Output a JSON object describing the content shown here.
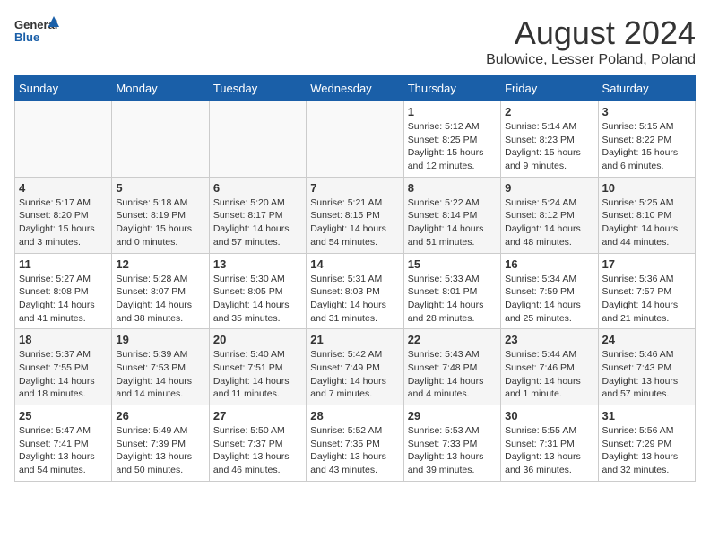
{
  "header": {
    "logo_general": "General",
    "logo_blue": "Blue",
    "month_title": "August 2024",
    "subtitle": "Bulowice, Lesser Poland, Poland"
  },
  "days_of_week": [
    "Sunday",
    "Monday",
    "Tuesday",
    "Wednesday",
    "Thursday",
    "Friday",
    "Saturday"
  ],
  "weeks": [
    [
      {
        "day": "",
        "info": ""
      },
      {
        "day": "",
        "info": ""
      },
      {
        "day": "",
        "info": ""
      },
      {
        "day": "",
        "info": ""
      },
      {
        "day": "1",
        "info": "Sunrise: 5:12 AM\nSunset: 8:25 PM\nDaylight: 15 hours\nand 12 minutes."
      },
      {
        "day": "2",
        "info": "Sunrise: 5:14 AM\nSunset: 8:23 PM\nDaylight: 15 hours\nand 9 minutes."
      },
      {
        "day": "3",
        "info": "Sunrise: 5:15 AM\nSunset: 8:22 PM\nDaylight: 15 hours\nand 6 minutes."
      }
    ],
    [
      {
        "day": "4",
        "info": "Sunrise: 5:17 AM\nSunset: 8:20 PM\nDaylight: 15 hours\nand 3 minutes."
      },
      {
        "day": "5",
        "info": "Sunrise: 5:18 AM\nSunset: 8:19 PM\nDaylight: 15 hours\nand 0 minutes."
      },
      {
        "day": "6",
        "info": "Sunrise: 5:20 AM\nSunset: 8:17 PM\nDaylight: 14 hours\nand 57 minutes."
      },
      {
        "day": "7",
        "info": "Sunrise: 5:21 AM\nSunset: 8:15 PM\nDaylight: 14 hours\nand 54 minutes."
      },
      {
        "day": "8",
        "info": "Sunrise: 5:22 AM\nSunset: 8:14 PM\nDaylight: 14 hours\nand 51 minutes."
      },
      {
        "day": "9",
        "info": "Sunrise: 5:24 AM\nSunset: 8:12 PM\nDaylight: 14 hours\nand 48 minutes."
      },
      {
        "day": "10",
        "info": "Sunrise: 5:25 AM\nSunset: 8:10 PM\nDaylight: 14 hours\nand 44 minutes."
      }
    ],
    [
      {
        "day": "11",
        "info": "Sunrise: 5:27 AM\nSunset: 8:08 PM\nDaylight: 14 hours\nand 41 minutes."
      },
      {
        "day": "12",
        "info": "Sunrise: 5:28 AM\nSunset: 8:07 PM\nDaylight: 14 hours\nand 38 minutes."
      },
      {
        "day": "13",
        "info": "Sunrise: 5:30 AM\nSunset: 8:05 PM\nDaylight: 14 hours\nand 35 minutes."
      },
      {
        "day": "14",
        "info": "Sunrise: 5:31 AM\nSunset: 8:03 PM\nDaylight: 14 hours\nand 31 minutes."
      },
      {
        "day": "15",
        "info": "Sunrise: 5:33 AM\nSunset: 8:01 PM\nDaylight: 14 hours\nand 28 minutes."
      },
      {
        "day": "16",
        "info": "Sunrise: 5:34 AM\nSunset: 7:59 PM\nDaylight: 14 hours\nand 25 minutes."
      },
      {
        "day": "17",
        "info": "Sunrise: 5:36 AM\nSunset: 7:57 PM\nDaylight: 14 hours\nand 21 minutes."
      }
    ],
    [
      {
        "day": "18",
        "info": "Sunrise: 5:37 AM\nSunset: 7:55 PM\nDaylight: 14 hours\nand 18 minutes."
      },
      {
        "day": "19",
        "info": "Sunrise: 5:39 AM\nSunset: 7:53 PM\nDaylight: 14 hours\nand 14 minutes."
      },
      {
        "day": "20",
        "info": "Sunrise: 5:40 AM\nSunset: 7:51 PM\nDaylight: 14 hours\nand 11 minutes."
      },
      {
        "day": "21",
        "info": "Sunrise: 5:42 AM\nSunset: 7:49 PM\nDaylight: 14 hours\nand 7 minutes."
      },
      {
        "day": "22",
        "info": "Sunrise: 5:43 AM\nSunset: 7:48 PM\nDaylight: 14 hours\nand 4 minutes."
      },
      {
        "day": "23",
        "info": "Sunrise: 5:44 AM\nSunset: 7:46 PM\nDaylight: 14 hours\nand 1 minute."
      },
      {
        "day": "24",
        "info": "Sunrise: 5:46 AM\nSunset: 7:43 PM\nDaylight: 13 hours\nand 57 minutes."
      }
    ],
    [
      {
        "day": "25",
        "info": "Sunrise: 5:47 AM\nSunset: 7:41 PM\nDaylight: 13 hours\nand 54 minutes."
      },
      {
        "day": "26",
        "info": "Sunrise: 5:49 AM\nSunset: 7:39 PM\nDaylight: 13 hours\nand 50 minutes."
      },
      {
        "day": "27",
        "info": "Sunrise: 5:50 AM\nSunset: 7:37 PM\nDaylight: 13 hours\nand 46 minutes."
      },
      {
        "day": "28",
        "info": "Sunrise: 5:52 AM\nSunset: 7:35 PM\nDaylight: 13 hours\nand 43 minutes."
      },
      {
        "day": "29",
        "info": "Sunrise: 5:53 AM\nSunset: 7:33 PM\nDaylight: 13 hours\nand 39 minutes."
      },
      {
        "day": "30",
        "info": "Sunrise: 5:55 AM\nSunset: 7:31 PM\nDaylight: 13 hours\nand 36 minutes."
      },
      {
        "day": "31",
        "info": "Sunrise: 5:56 AM\nSunset: 7:29 PM\nDaylight: 13 hours\nand 32 minutes."
      }
    ]
  ]
}
